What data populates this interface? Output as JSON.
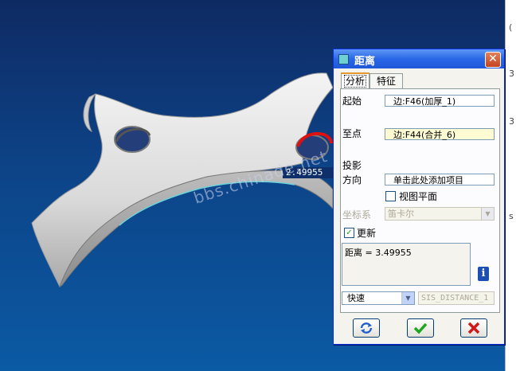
{
  "viewport": {
    "measure_value": "2.49955",
    "watermark": "bbs.chinade.net"
  },
  "right_strip": {
    "glyphs": [
      "(",
      "3",
      "3",
      "s"
    ]
  },
  "dialog": {
    "title": "距离",
    "close_label": "✕",
    "tabs": [
      {
        "label": "分析",
        "active": true
      },
      {
        "label": "特征",
        "active": false
      }
    ],
    "start_label": "起始",
    "start_value": "边:F46(加厚_1)",
    "end_label": "至点",
    "end_value": "边:F44(合并_6)",
    "projection_label": "投影",
    "direction_label": "方向",
    "direction_placeholder": "单击此处添加项目",
    "view_plane_label": "视图平面",
    "view_plane_checked": false,
    "coord_label": "坐标系",
    "coord_value": "笛卡尔",
    "update_label": "更新",
    "update_checked": true,
    "result_text": "距离 = 3.49955",
    "info_icon": "i",
    "mode_value": "快速",
    "feature_name": "SIS_DISTANCE_1",
    "buttons": {
      "repeat": "repeat-icon",
      "ok": "check-icon",
      "cancel": "x-icon"
    },
    "colors": {
      "title_bar": "#2a67e6",
      "ok_check": "#1ea61e",
      "cancel_x": "#d01919",
      "end_field_bg": "#fffcd4"
    }
  }
}
